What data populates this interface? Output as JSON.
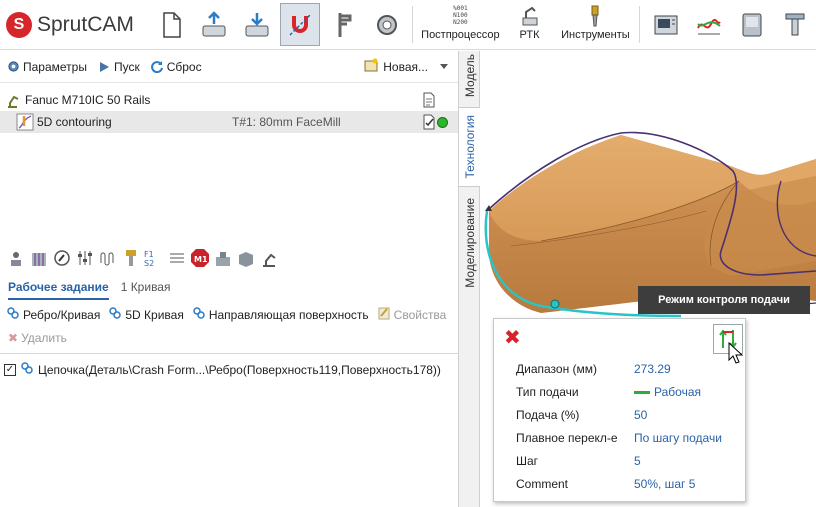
{
  "app": {
    "logo_letter": "S",
    "name": "SprutCAM"
  },
  "toolbar": {
    "postprocessor_lines": [
      "%001",
      "N100",
      "N200"
    ],
    "postprocessor_label": "Постпроцессор",
    "rtk_label": "РТК",
    "tools_label": "Инструменты"
  },
  "actions": {
    "params": "Параметры",
    "run": "Пуск",
    "reset": "Сброс",
    "new": "Новая..."
  },
  "tree": {
    "machine": "Fanuc M710IC 50 Rails",
    "operation": "5D contouring",
    "tool": "T#1: 80mm FaceMill"
  },
  "tabs": {
    "job": "Рабочее задание",
    "curves": "1 Кривая"
  },
  "job_actions": {
    "rib_curve": "Ребро/Кривая",
    "curve5d": "5D Кривая",
    "guide_surface": "Направляющая поверхность",
    "properties": "Свойства",
    "delete": "Удалить"
  },
  "chain": {
    "text": "Цепочка(Деталь\\Crash Form...\\Ребро(Поверхность119,Поверхность178))",
    "checked": "✓"
  },
  "vertical_tabs": {
    "model": "Модель",
    "technology": "Технология",
    "modeling": "Моделирование"
  },
  "tooltip": "Режим контроля подачи",
  "popup": {
    "close": "✖",
    "rows": [
      {
        "label": "Диапазон (мм)",
        "value": "273.29"
      },
      {
        "label": "Тип подачи",
        "value": "Рабочая"
      },
      {
        "label": "Подача (%)",
        "value": "50"
      },
      {
        "label": "Плавное перекл-е",
        "value": "По шагу подачи"
      },
      {
        "label": "Шаг",
        "value": "5"
      },
      {
        "label": "Comment",
        "value": "50%, шаг 5"
      }
    ]
  },
  "colors": {
    "accent": "#2a63a8",
    "brand": "#d7262b",
    "part": "#d9a062",
    "path": "#4a3070",
    "edge": "#29c4c8",
    "ok": "#2db52d"
  },
  "icons": [
    "new-file-icon",
    "open-icon",
    "save-icon",
    "magnet-icon",
    "caliper-icon",
    "measure-icon",
    "postprocessor-icon",
    "rtk-icon",
    "tools-icon",
    "machine-icon",
    "graph-icon",
    "simulation-icon",
    "settings-icon"
  ]
}
